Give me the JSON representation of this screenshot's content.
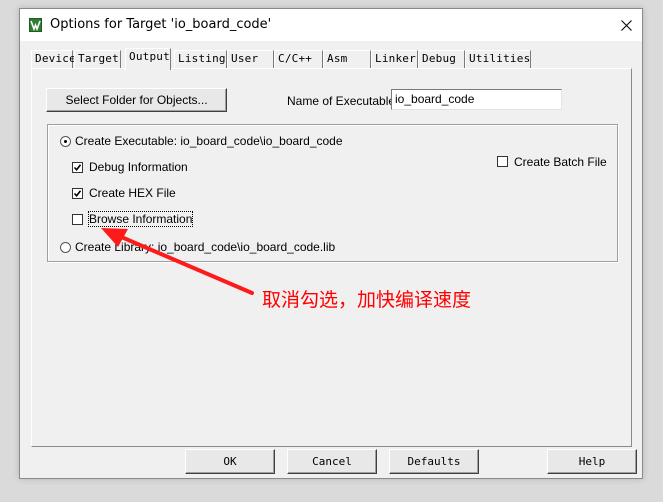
{
  "window": {
    "title": "Options for Target 'io_board_code'"
  },
  "tabs": [
    {
      "label": "Device",
      "active": false
    },
    {
      "label": "Target",
      "active": false
    },
    {
      "label": "Output",
      "active": true
    },
    {
      "label": "Listing",
      "active": false
    },
    {
      "label": "User",
      "active": false
    },
    {
      "label": "C/C++",
      "active": false
    },
    {
      "label": "Asm",
      "active": false
    },
    {
      "label": "Linker",
      "active": false
    },
    {
      "label": "Debug",
      "active": false
    },
    {
      "label": "Utilities",
      "active": false
    }
  ],
  "output": {
    "select_folder_label": "Select Folder for Objects...",
    "name_of_executable_label": "Name of Executable:",
    "name_of_executable_value": "io_board_code",
    "create_executable": {
      "label": "Create Executable:  io_board_code\\io_board_code",
      "selected": true
    },
    "debug_information": {
      "label": "Debug Information",
      "checked": true
    },
    "create_hex_file": {
      "label": "Create HEX File",
      "checked": true
    },
    "browse_information": {
      "label": "Browse Information",
      "checked": false
    },
    "create_library": {
      "label": "Create Library:  io_board_code\\io_board_code.lib",
      "selected": false
    },
    "create_batch_file": {
      "label": "Create Batch File",
      "checked": false
    }
  },
  "buttons": {
    "ok": "OK",
    "cancel": "Cancel",
    "defaults": "Defaults",
    "help": "Help"
  },
  "annotation": {
    "text": "取消勾选，加快编译速度",
    "color": "#ff0000"
  },
  "icons": {
    "app": "keil-uvision-icon",
    "close": "close-icon",
    "check": "check-icon"
  }
}
